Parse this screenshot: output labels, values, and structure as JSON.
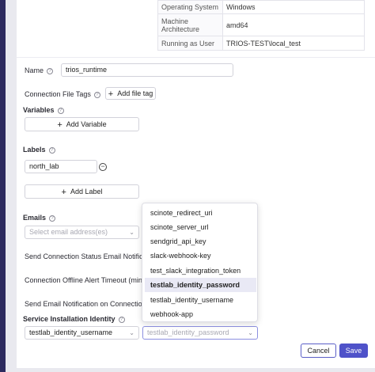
{
  "system_info": [
    {
      "key": "Operating System",
      "value": "Windows"
    },
    {
      "key": "Machine Architecture",
      "value": "amd64"
    },
    {
      "key": "Running as User",
      "value": "TRIOS-TEST\\local_test"
    }
  ],
  "name": {
    "label": "Name",
    "value": "trios_runtime"
  },
  "connection_file_tags": {
    "label": "Connection File Tags",
    "add_label": "Add file tag"
  },
  "variables": {
    "label": "Variables",
    "add_label": "Add Variable"
  },
  "labels": {
    "label": "Labels",
    "items": [
      "north_lab"
    ],
    "add_label": "Add Label"
  },
  "emails": {
    "label": "Emails",
    "placeholder": "Select email address(es)"
  },
  "send_status_email": {
    "label": "Send Connection Status Email Notificatio"
  },
  "offline_alert_timeout": {
    "label": "Connection Offline Alert Timeout (min)"
  },
  "send_email_on_connection": {
    "label": "Send Email Notification on Connection S"
  },
  "service_installation_identity": {
    "label": "Service Installation Identity",
    "selected_value": "testlab_identity_username",
    "second_placeholder": "testlab_identity_password"
  },
  "dropdown": {
    "options": [
      "scinote_redirect_uri",
      "scinote_server_url",
      "sendgrid_api_key",
      "slack-webhook-key",
      "test_slack_integration_token",
      "testlab_identity_password",
      "testlab_identity_username",
      "webhook-app"
    ],
    "selected": "testlab_identity_password"
  },
  "footer": {
    "cancel_label": "Cancel",
    "save_label": "Save"
  },
  "colors": {
    "accent": "#4f52c9",
    "rail": "#2c2a5e"
  },
  "icons": {
    "help": "help-circle-icon",
    "add": "plus-icon",
    "remove": "minus-circle-icon",
    "chevron": "chevron-down-icon"
  }
}
